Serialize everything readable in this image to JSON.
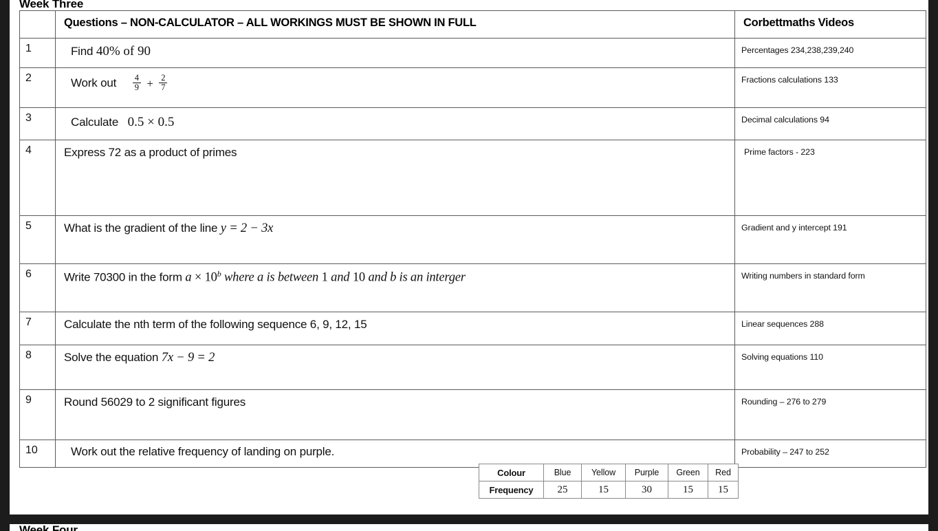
{
  "document": {
    "page_one_title": "Week Three",
    "page_two_title": "Week Four"
  },
  "table": {
    "headers": {
      "number": "",
      "questions": "Questions – NON-CALCULATOR – ALL WORKINGS MUST BE SHOWN IN FULL",
      "videos": "Corbettmaths Videos"
    },
    "rows": [
      {
        "number": "1",
        "question_plain": "Find 40% of 90",
        "question_lead": "Find",
        "math_a": "40% of 90",
        "video": "Percentages 234,238,239,240"
      },
      {
        "number": "2",
        "question_plain": "Work out 4/9 + 2/7",
        "question_lead": "Work out",
        "frac1_num": "4",
        "frac1_den": "9",
        "frac_op": "+",
        "frac2_num": "2",
        "frac2_den": "7",
        "video": "Fractions calculations 133"
      },
      {
        "number": "3",
        "question_plain": "Calculate 0.5 × 0.5",
        "question_lead": "Calculate",
        "math_a": "0.5 × 0.5",
        "video": "Decimal calculations 94"
      },
      {
        "number": "4",
        "question_plain": "Express 72 as a product of primes",
        "video": "Prime factors - 223"
      },
      {
        "number": "5",
        "question_plain": "What is the gradient of the line y = 2 − 3x",
        "question_lead": "What is the gradient of the line",
        "math_a": "y = 2 − 3x",
        "video": "Gradient and y intercept 191"
      },
      {
        "number": "6",
        "question_plain": "Write 70300 in the form a × 10^b where a is between 1 and 10 and b is an interger",
        "question_lead": "Write 70300 in the form",
        "math_a": "a",
        "math_b": "× 10",
        "math_sup": "b",
        "math_c": "where a is between",
        "math_d": "1",
        "math_e": "and",
        "math_f": "10",
        "math_g": "and b is an interger",
        "video": "Writing numbers in standard form"
      },
      {
        "number": "7",
        "question_plain": "Calculate the nth term of the following sequence 6, 9, 12, 15",
        "video": "Linear sequences 288"
      },
      {
        "number": "8",
        "question_plain": "Solve the equation 7x − 9 = 2",
        "question_lead": "Solve the equation",
        "math_a": "7x − 9 = 2",
        "video": "Solving equations 110"
      },
      {
        "number": "9",
        "question_plain": "Round 56029 to 2 significant figures",
        "video": "Rounding – 276 to 279"
      },
      {
        "number": "10",
        "question_plain": "Work out the relative frequency of landing on purple.",
        "video": "Probability – 247 to 252"
      }
    ]
  },
  "frequency_table": {
    "row_labels": [
      "Colour",
      "Frequency"
    ],
    "colours": [
      "Blue",
      "Yellow",
      "Purple",
      "Green",
      "Red"
    ],
    "frequencies": [
      "25",
      "15",
      "30",
      "15",
      "15"
    ]
  },
  "colors": {
    "page_background": "#ffffff",
    "viewer_background": "#1c1c1c",
    "text": "#111111",
    "border_outer": "#3a3a3a",
    "border_inner": "#5a5a5a"
  }
}
